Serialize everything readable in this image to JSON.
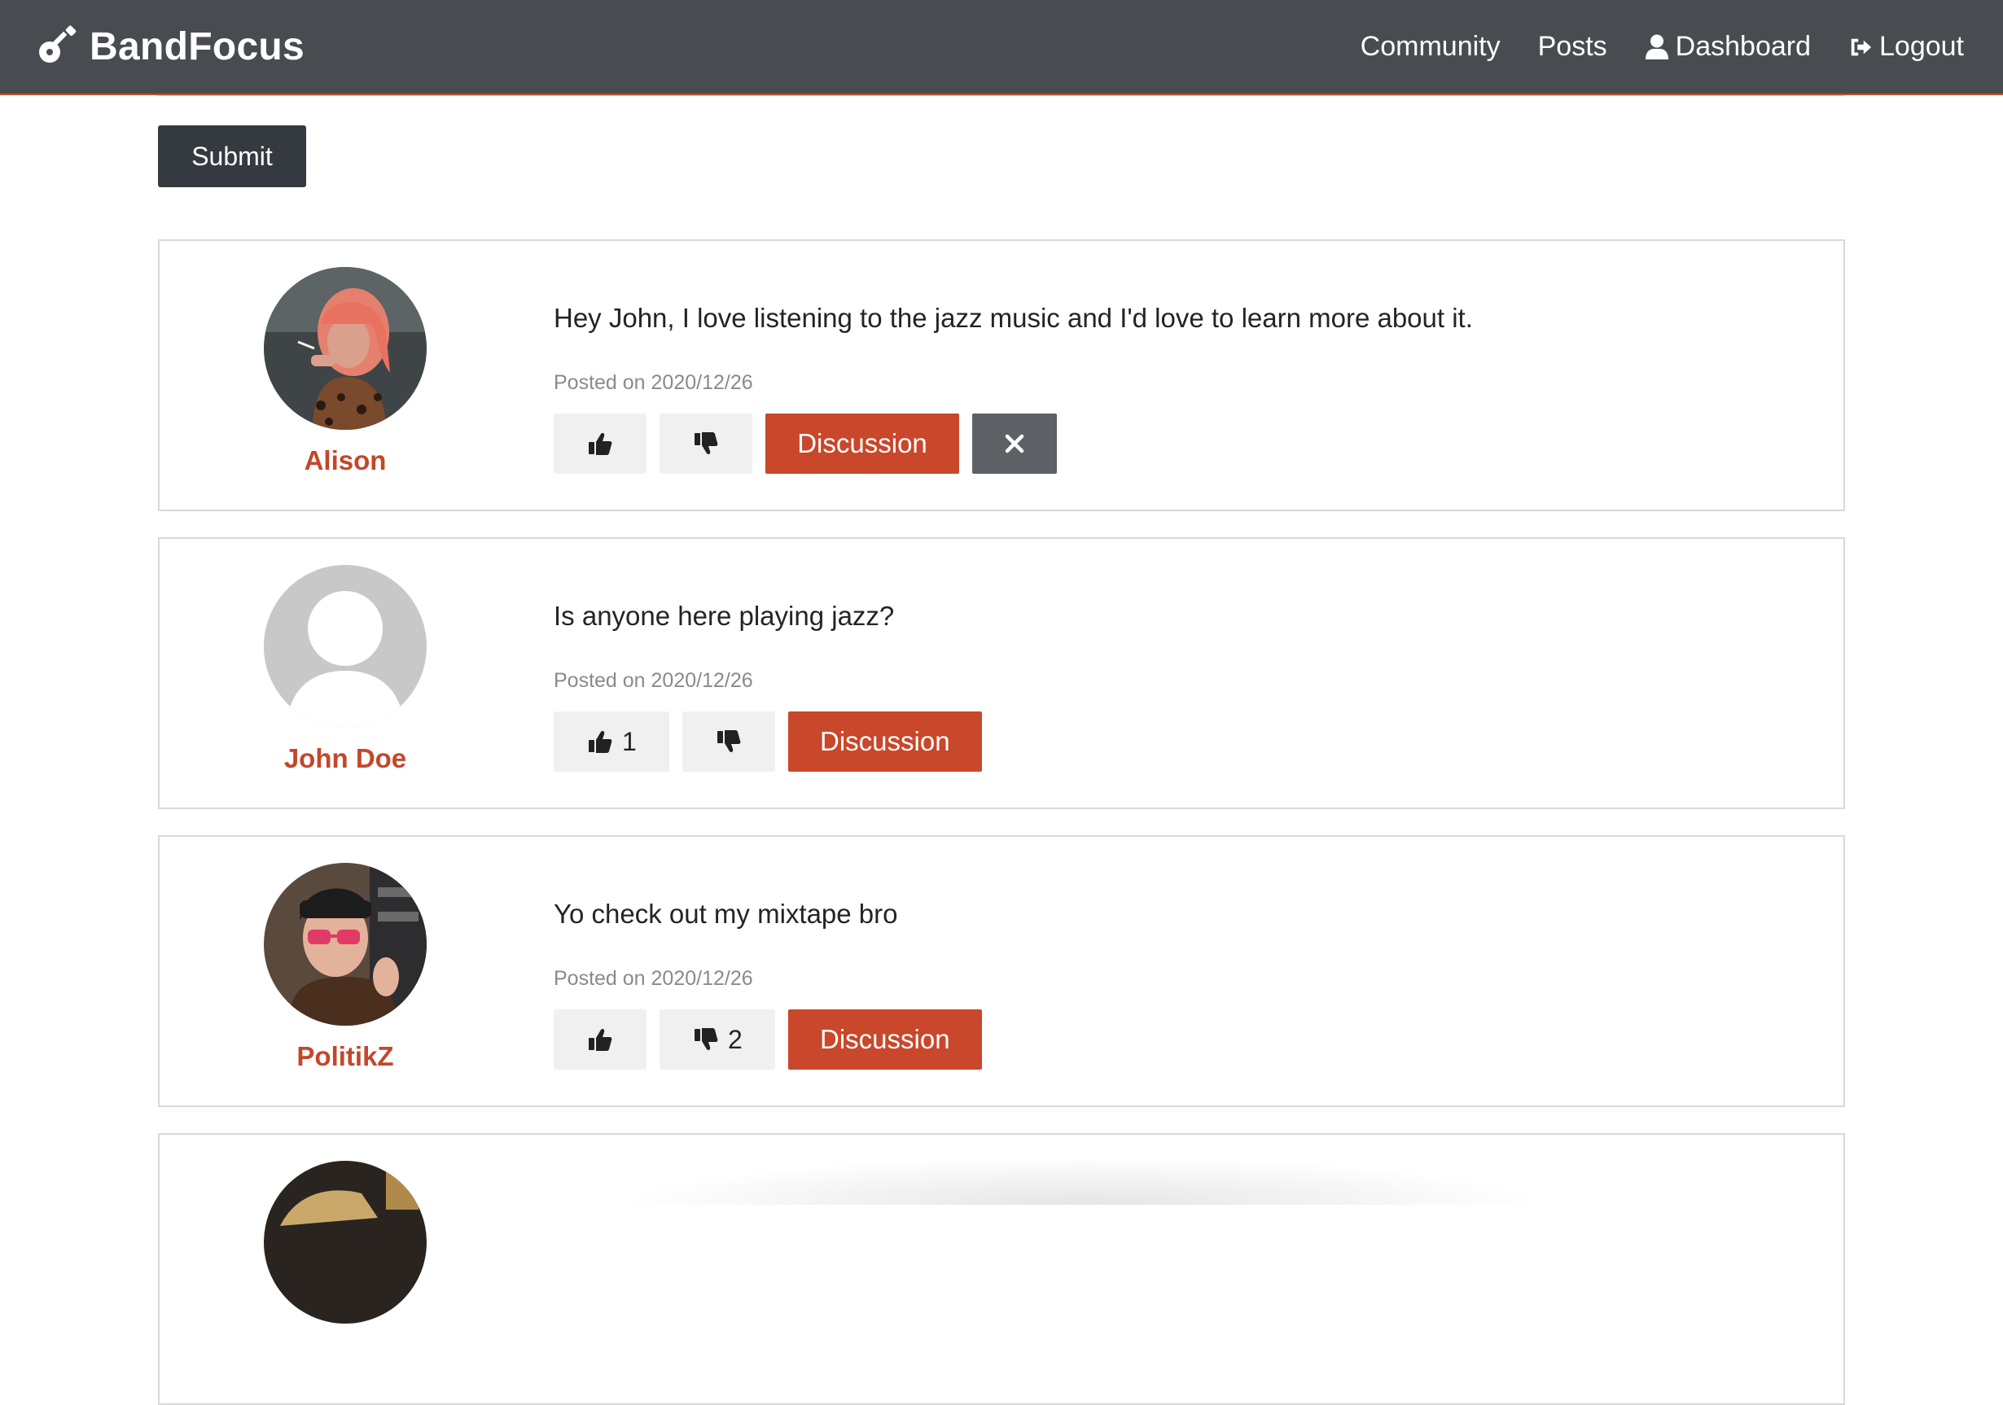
{
  "nav": {
    "brand": "BandFocus",
    "links": [
      {
        "label": "Community",
        "icon": ""
      },
      {
        "label": "Posts",
        "icon": ""
      },
      {
        "label": "Dashboard",
        "icon": "user-icon"
      },
      {
        "label": "Logout",
        "icon": "sign-out-icon"
      }
    ]
  },
  "form": {
    "submit_label": "Submit"
  },
  "posts": [
    {
      "author": "Alison",
      "text": "Hey John, I love listening to the jazz music and I'd love to learn more about it.",
      "date": "Posted on 2020/12/26",
      "likes": "",
      "dislikes": "",
      "discussion_label": "Discussion",
      "deletable": true
    },
    {
      "author": "John Doe",
      "text": "Is anyone here playing jazz?",
      "date": "Posted on 2020/12/26",
      "likes": "1",
      "dislikes": "",
      "discussion_label": "Discussion",
      "deletable": false
    },
    {
      "author": "PolitikZ",
      "text": "Yo check out my mixtape bro",
      "date": "Posted on 2020/12/26",
      "likes": "",
      "dislikes": "2",
      "discussion_label": "Discussion",
      "deletable": false
    }
  ],
  "colors": {
    "navbar": "#484c51",
    "accent": "#c9472a",
    "author": "#c4472a",
    "submit": "#343a40",
    "delete": "#5d6166"
  }
}
